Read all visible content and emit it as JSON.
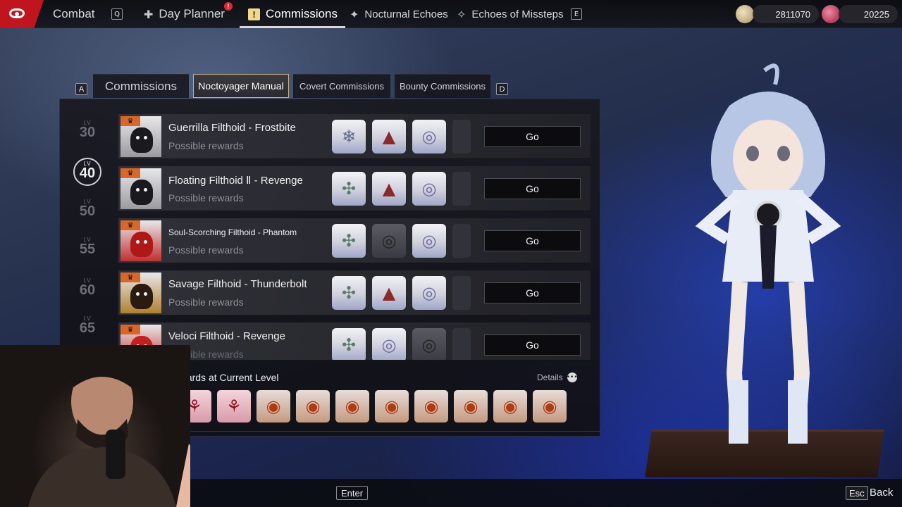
{
  "topnav": {
    "combat": "Combat",
    "combat_key": "Q",
    "day_planner": "Day Planner",
    "day_planner_alert": "!",
    "commissions": "Commissions",
    "nocturnal_echoes": "Nocturnal Echoes",
    "echoes_of_missteps": "Echoes of Missteps",
    "next_key": "E"
  },
  "currency": [
    {
      "icon": "shell-coin-icon",
      "value": "2811070",
      "color": "#c9b58a"
    },
    {
      "icon": "red-gem-icon",
      "value": "20225",
      "color": "#c23456"
    }
  ],
  "tabs": {
    "prev_key": "A",
    "next_key": "D",
    "items": [
      {
        "label": "Commissions"
      },
      {
        "label": "Noctoyager Manual",
        "active": true
      },
      {
        "label": "Covert Commissions"
      },
      {
        "label": "Bounty Commissions"
      }
    ]
  },
  "levels": [
    {
      "lbl": "LV",
      "num": "30"
    },
    {
      "lbl": "LV",
      "num": "40",
      "current": true
    },
    {
      "lbl": "LV",
      "num": "50"
    },
    {
      "lbl": "LV",
      "num": "55"
    },
    {
      "lbl": "LV",
      "num": "60"
    },
    {
      "lbl": "LV",
      "num": "65"
    }
  ],
  "commissions": [
    {
      "title": "Guerrilla Filthoid - Frostbite",
      "sub": "Possible rewards",
      "go": "Go"
    },
    {
      "title": "Floating Filthoid Ⅱ - Revenge",
      "sub": "Possible rewards",
      "go": "Go"
    },
    {
      "title": "Soul-Scorching Filthoid - Phantom",
      "sub": "Possible rewards",
      "go": "Go"
    },
    {
      "title": "Savage Filthoid - Thunderbolt",
      "sub": "Possible rewards",
      "go": "Go"
    },
    {
      "title": "Veloci Filthoid - Revenge",
      "sub": "Possible rewards",
      "go": "Go"
    }
  ],
  "bottom": {
    "title": "Possible Rewards at Current Level",
    "details": "Details",
    "details_icon": "•••"
  },
  "footer": {
    "enter": "Enter",
    "esc": "Esc",
    "back": "Back"
  }
}
